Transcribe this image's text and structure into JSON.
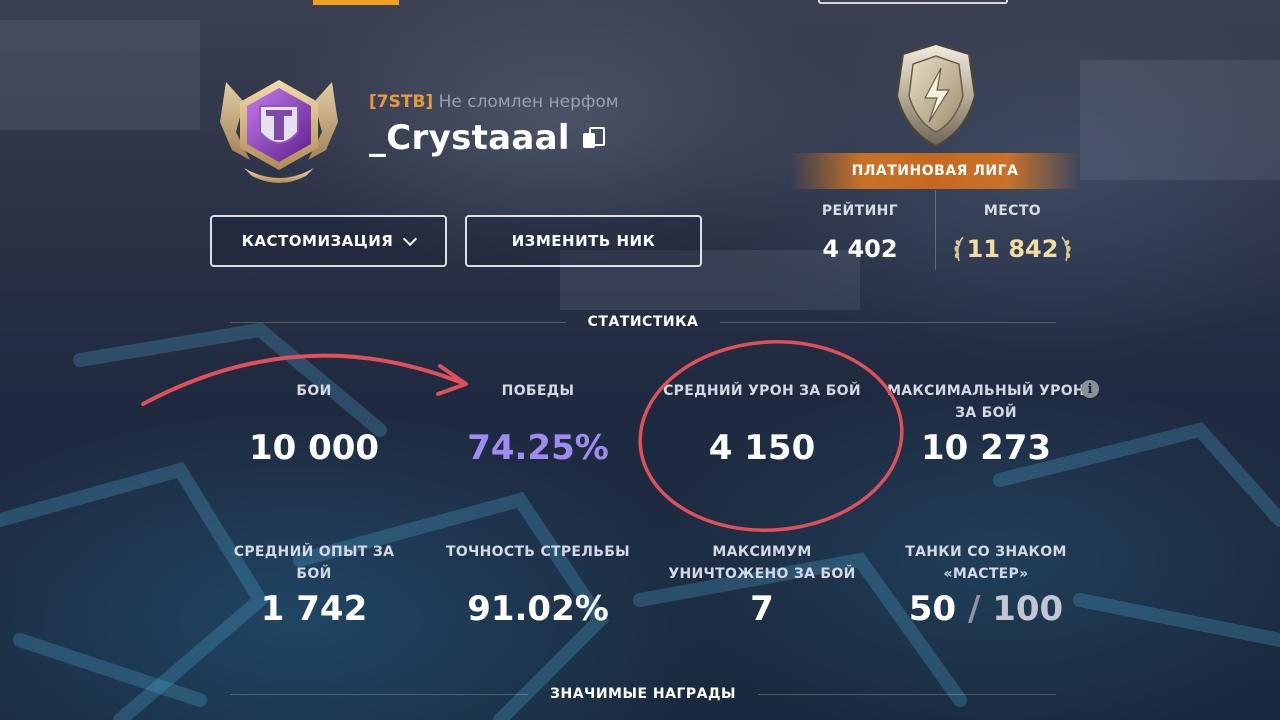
{
  "player": {
    "clan_tag": "[7STB]",
    "clan_name": "Не сломлен нерфом",
    "nickname": "_Crystaaal"
  },
  "buttons": {
    "customize": "КАСТОМИЗАЦИЯ",
    "change_nick": "ИЗМЕНИТЬ НИК"
  },
  "league": {
    "name": "ПЛАТИНОВАЯ ЛИГА",
    "rating_label": "РЕЙТИНГ",
    "rating_value": "4 402",
    "place_label": "МЕСТО",
    "place_value": "11 842"
  },
  "sections": {
    "stats": "СТАТИСТИКА",
    "awards": "ЗНАЧИМЫЕ НАГРАДЫ"
  },
  "stats": [
    {
      "label": "БОИ",
      "value": "10 000"
    },
    {
      "label": "ПОБЕДЫ",
      "value": "74.25%"
    },
    {
      "label": "СРЕДНИЙ УРОН ЗА БОЙ",
      "value": "4 150"
    },
    {
      "label": "МАКСИМАЛЬНЫЙ УРОН ЗА БОЙ",
      "value": "10 273"
    },
    {
      "label": "СРЕДНИЙ ОПЫТ ЗА БОЙ",
      "value": "1 742"
    },
    {
      "label": "ТОЧНОСТЬ СТРЕЛЬБЫ",
      "value": "91.02%"
    },
    {
      "label": "МАКСИМУМ УНИЧТОЖЕНО ЗА БОЙ",
      "value": "7"
    },
    {
      "label": "ТАНКИ СО ЗНАКОМ «МАСТЕР»",
      "value": "50",
      "total": "100"
    }
  ],
  "colors": {
    "accent_orange": "#f0a020",
    "wins_purple": "#a08cf0",
    "annotation_red": "#e0505a"
  }
}
